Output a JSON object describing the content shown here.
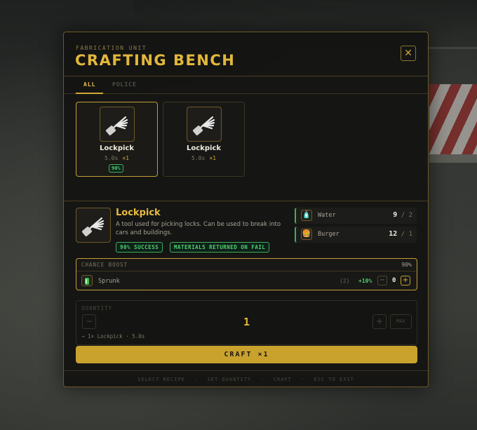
{
  "header": {
    "eyebrow": "FABRICATION UNIT",
    "title": "CRAFTING BENCH",
    "close_label": "✕"
  },
  "tabs": [
    {
      "label": "ALL",
      "active": true
    },
    {
      "label": "POLICE",
      "active": false
    }
  ],
  "recipes": [
    {
      "name": "Lockpick",
      "time": "5.0s",
      "qty": "×1",
      "badge": "90%",
      "selected": true,
      "icon": "lockpick-icon"
    },
    {
      "name": "Lockpick",
      "time": "5.0s",
      "qty": "×1",
      "badge": "",
      "selected": false,
      "icon": "lockpick-icon"
    }
  ],
  "detail": {
    "name": "Lockpick",
    "description": "A tool used for picking locks. Can be used to break into cars and buildings.",
    "success_pill": "90% SUCCESS",
    "fail_pill": "MATERIALS RETURNED ON FAIL"
  },
  "materials": [
    {
      "name": "Water",
      "have": "9",
      "need": "2",
      "icon": "water-bottle-icon",
      "glyph": "🧴"
    },
    {
      "name": "Burger",
      "have": "12",
      "need": "1",
      "icon": "burger-icon",
      "glyph": "🍔"
    }
  ],
  "boost": {
    "label": "CHANCE BOOST",
    "total_pct": "90%",
    "item_name": "Sprunk",
    "owned": "(2)",
    "gain": "+10%",
    "minus": "−",
    "value": "0",
    "plus": "+"
  },
  "quantity": {
    "label": "QUANTITY",
    "minus": "−",
    "value": "1",
    "plus": "+",
    "max": "MAX",
    "summary": "→ 1× Lockpick · 5.0s"
  },
  "craft_button": "CRAFT ×1",
  "footer": [
    "SELECT RECIPE",
    "·",
    "SET QUANTITY",
    "·",
    "CRAFT",
    "·",
    "ESC TO EXIT"
  ],
  "colors": {
    "accent": "#e2b73b",
    "success": "#4fd16e",
    "panel": "#141413"
  }
}
